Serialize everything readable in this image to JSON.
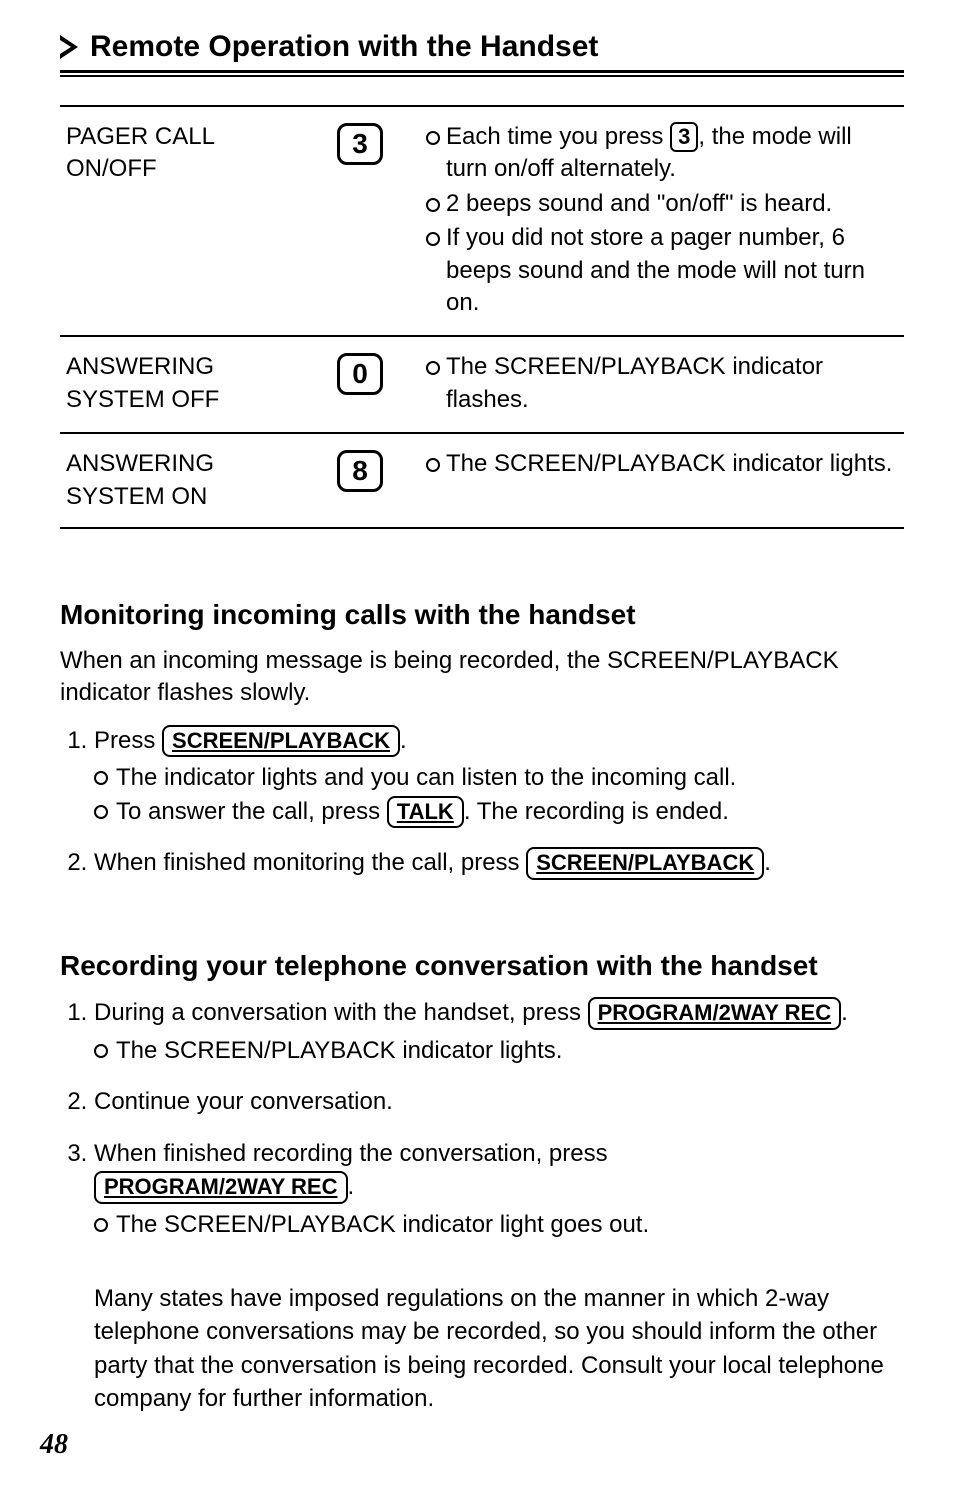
{
  "title": "Remote Operation with the Handset",
  "table": {
    "rows": [
      {
        "label": "PAGER CALL ON/OFF",
        "key": "3",
        "desc": {
          "b1a": "Each time you press ",
          "b1key": "3",
          "b1b": ", the mode will turn on/off alternately.",
          "b2": "2 beeps sound and \"on/off\" is heard.",
          "b3": "If you did not store a pager number, 6 beeps sound and the mode will not turn on."
        }
      },
      {
        "label": "ANSWERING SYSTEM OFF",
        "key": "0",
        "desc": {
          "b1": "The SCREEN/PLAYBACK indicator flashes."
        }
      },
      {
        "label": "ANSWERING SYSTEM ON",
        "key": "8",
        "desc": {
          "b1": "The SCREEN/PLAYBACK indicator lights."
        }
      }
    ]
  },
  "section1": {
    "heading": "Monitoring incoming calls with the handset",
    "intro": "When an incoming message is being recorded, the SCREEN/PLAYBACK indicator flashes slowly.",
    "step1_pre": "Press ",
    "step1_btn": "SCREEN/PLAYBACK",
    "step1_post": ".",
    "step1_sub1": "The indicator lights and you can listen to the incoming call.",
    "step1_sub2a": "To answer the call, press ",
    "step1_sub2_btn": "TALK",
    "step1_sub2b": ". The recording is ended.",
    "step2_pre": "When finished monitoring the call, press ",
    "step2_btn": "SCREEN/PLAYBACK",
    "step2_post": "."
  },
  "section2": {
    "heading": "Recording your telephone conversation with the handset",
    "step1_pre": "During a conversation with the handset, press ",
    "step1_btn": "PROGRAM/2WAY REC",
    "step1_post": ".",
    "step1_sub1": "The SCREEN/PLAYBACK indicator lights.",
    "step2": "Continue your conversation.",
    "step3_line1": "When finished recording the conversation, press",
    "step3_btn": "PROGRAM/2WAY REC",
    "step3_post": ".",
    "step3_sub1": "The SCREEN/PLAYBACK indicator light goes out."
  },
  "note": "Many states have imposed regulations on the manner in which 2-way telephone conversations may be recorded, so you should inform the other party that the conversation is being recorded. Consult your local telephone company for further information.",
  "page_number": "48"
}
